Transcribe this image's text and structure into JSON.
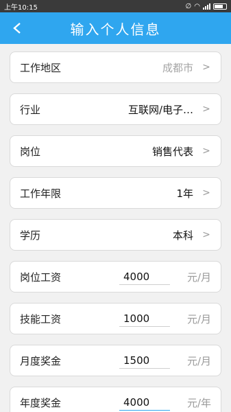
{
  "status_bar": {
    "time": "上午10:15"
  },
  "header": {
    "title": "输入个人信息"
  },
  "form": {
    "work_area": {
      "label": "工作地区",
      "placeholder": "成都市"
    },
    "industry": {
      "label": "行业",
      "value": "互联网/电子…"
    },
    "position": {
      "label": "岗位",
      "value": "销售代表"
    },
    "work_years": {
      "label": "工作年限",
      "value": "1年"
    },
    "education": {
      "label": "学历",
      "value": "本科"
    },
    "position_salary": {
      "label": "岗位工资",
      "value": "4000",
      "unit": "元/月"
    },
    "skill_salary": {
      "label": "技能工资",
      "value": "1000",
      "unit": "元/月"
    },
    "monthly_bonus": {
      "label": "月度奖金",
      "value": "1500",
      "unit": "元/月"
    },
    "annual_bonus": {
      "label": "年度奖金",
      "value": "4000",
      "unit": "元/年"
    }
  },
  "colors": {
    "header": "#2fa6ef",
    "background": "#f1f1f1"
  },
  "icons": [
    "back-icon",
    "chevron-right-icon",
    "wifi-icon",
    "signal-icon",
    "battery-icon",
    "mute-icon"
  ]
}
